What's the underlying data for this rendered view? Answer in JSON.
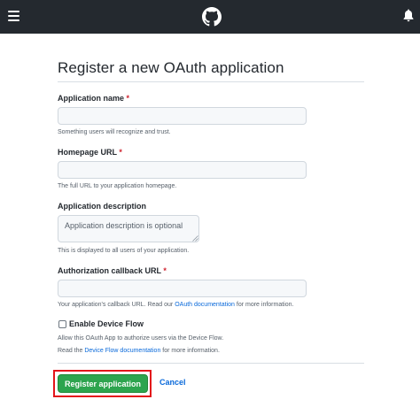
{
  "header": {
    "menu_icon": "hamburger-icon",
    "logo_icon": "github-octocat-icon",
    "notifications_icon": "bell-icon",
    "background": "#24292f"
  },
  "page": {
    "title": "Register a new OAuth application"
  },
  "form": {
    "app_name": {
      "label": "Application name",
      "required_mark": "*",
      "value": "",
      "hint": "Something users will recognize and trust."
    },
    "homepage_url": {
      "label": "Homepage URL",
      "required_mark": "*",
      "value": "",
      "hint": "The full URL to your application homepage."
    },
    "description": {
      "label": "Application description",
      "placeholder": "Application description is optional",
      "hint": "This is displayed to all users of your application."
    },
    "callback_url": {
      "label": "Authorization callback URL",
      "required_mark": "*",
      "value": "",
      "hint_before": "Your application's callback URL. Read our ",
      "hint_link": "OAuth documentation",
      "hint_after": " for more information."
    },
    "device_flow": {
      "label": "Enable Device Flow",
      "checked": false,
      "hint_line1": "Allow this OAuth App to authorize users via the Device Flow.",
      "hint_line2_before": "Read the ",
      "hint_line2_link": "Device Flow documentation",
      "hint_line2_after": " for more information."
    }
  },
  "actions": {
    "register_label": "Register application",
    "cancel_label": "Cancel",
    "register_color": "#2da44e",
    "highlight_color": "#e3141a",
    "link_color": "#0969da"
  }
}
